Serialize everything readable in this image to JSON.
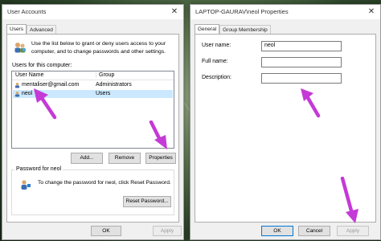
{
  "left_window": {
    "title": "User Accounts",
    "tabs": [
      {
        "label": "Users"
      },
      {
        "label": "Advanced"
      }
    ],
    "intro_text": "Use the list below to grant or deny users access to your computer, and to change passwords and other settings.",
    "users_label": "Users for this computer:",
    "table": {
      "columns": [
        "User Name",
        "Group"
      ],
      "rows": [
        {
          "name": "mentaliser@gmail.com",
          "group": "Administrators"
        },
        {
          "name": "neol",
          "group": "Users"
        }
      ]
    },
    "buttons": {
      "add": "Add...",
      "remove": "Remove",
      "properties": "Properties"
    },
    "password_group": {
      "title": "Password for neol",
      "text": "To change the password for neol, click Reset Password.",
      "reset_button": "Reset Password..."
    },
    "footer": {
      "ok": "OK",
      "apply": "Apply"
    }
  },
  "right_window": {
    "title": "LAPTOP-GAURAV\\neol Properties",
    "tabs": [
      {
        "label": "General"
      },
      {
        "label": "Group Membership"
      }
    ],
    "fields": [
      {
        "label": "User name:",
        "value": "neol"
      },
      {
        "label": "Full name:",
        "value": ""
      },
      {
        "label": "Description:",
        "value": ""
      }
    ],
    "footer": {
      "ok": "OK",
      "cancel": "Cancel",
      "apply": "Apply"
    }
  },
  "colors": {
    "arrow": "#c43ad6",
    "selection": "#cce8ff",
    "window_bg": "#f0f0f0"
  }
}
